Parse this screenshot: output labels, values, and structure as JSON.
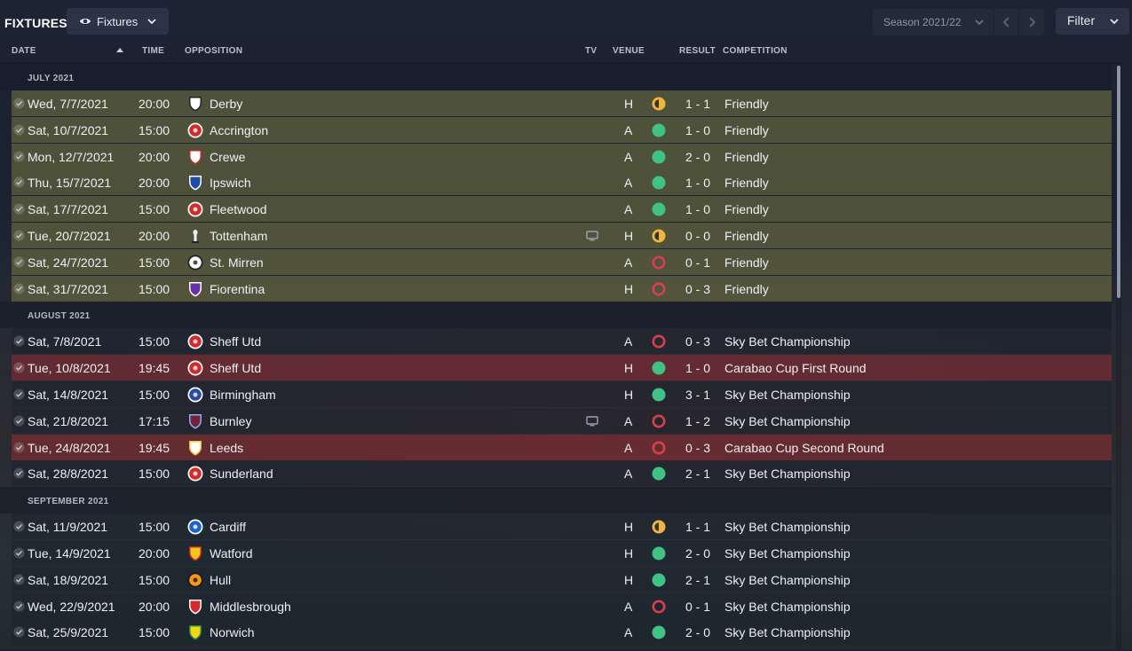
{
  "header": {
    "title": "FIXTURES",
    "view_label": "Fixtures",
    "season_label": "Season 2021/22",
    "filter_label": "Filter"
  },
  "columns": {
    "date": "DATE",
    "time": "TIME",
    "opposition": "OPPOSITION",
    "tv": "TV",
    "venue": "VENUE",
    "result": "RESULT",
    "competition": "COMPETITION"
  },
  "colors": {
    "win": "#3fc384",
    "draw": "#f0b540",
    "loss": "#d8404c",
    "july_row": "#707040",
    "cup_row": "#782c32"
  },
  "months": [
    {
      "label": "JULY 2021",
      "fixtures": [
        {
          "date": "Wed, 7/7/2021",
          "time": "20:00",
          "opponent": "Derby",
          "crest": "derby-ram",
          "tv": false,
          "venue": "H",
          "outcome": "draw",
          "score": "1 - 1",
          "competition": "Friendly",
          "highlight": "friendly"
        },
        {
          "date": "Sat, 10/7/2021",
          "time": "15:00",
          "opponent": "Accrington",
          "crest": "accrington",
          "tv": false,
          "venue": "A",
          "outcome": "win",
          "score": "1 - 0",
          "competition": "Friendly",
          "highlight": "friendly"
        },
        {
          "date": "Mon, 12/7/2021",
          "time": "20:00",
          "opponent": "Crewe",
          "crest": "crewe",
          "tv": false,
          "venue": "A",
          "outcome": "win",
          "score": "2 - 0",
          "competition": "Friendly",
          "highlight": "friendly"
        },
        {
          "date": "Thu, 15/7/2021",
          "time": "20:00",
          "opponent": "Ipswich",
          "crest": "ipswich",
          "tv": false,
          "venue": "A",
          "outcome": "win",
          "score": "1 - 0",
          "competition": "Friendly",
          "highlight": "friendly"
        },
        {
          "date": "Sat, 17/7/2021",
          "time": "15:00",
          "opponent": "Fleetwood",
          "crest": "fleetwood",
          "tv": false,
          "venue": "A",
          "outcome": "win",
          "score": "1 - 0",
          "competition": "Friendly",
          "highlight": "friendly"
        },
        {
          "date": "Tue, 20/7/2021",
          "time": "20:00",
          "opponent": "Tottenham",
          "crest": "tottenham",
          "tv": true,
          "venue": "H",
          "outcome": "draw",
          "score": "0 - 0",
          "competition": "Friendly",
          "highlight": "friendly"
        },
        {
          "date": "Sat, 24/7/2021",
          "time": "15:00",
          "opponent": "St. Mirren",
          "crest": "st-mirren",
          "tv": false,
          "venue": "A",
          "outcome": "loss",
          "score": "0 - 1",
          "competition": "Friendly",
          "highlight": "friendly"
        },
        {
          "date": "Sat, 31/7/2021",
          "time": "15:00",
          "opponent": "Fiorentina",
          "crest": "fiorentina",
          "tv": false,
          "venue": "H",
          "outcome": "loss",
          "score": "0 - 3",
          "competition": "Friendly",
          "highlight": "friendly"
        }
      ]
    },
    {
      "label": "AUGUST 2021",
      "fixtures": [
        {
          "date": "Sat, 7/8/2021",
          "time": "15:00",
          "opponent": "Sheff Utd",
          "crest": "sheff-utd",
          "tv": false,
          "venue": "A",
          "outcome": "loss",
          "score": "0 - 3",
          "competition": "Sky Bet Championship",
          "highlight": "normal"
        },
        {
          "date": "Tue, 10/8/2021",
          "time": "19:45",
          "opponent": "Sheff Utd",
          "crest": "sheff-utd",
          "tv": false,
          "venue": "H",
          "outcome": "win",
          "score": "1 - 0",
          "competition": "Carabao Cup First Round",
          "highlight": "cup"
        },
        {
          "date": "Sat, 14/8/2021",
          "time": "15:00",
          "opponent": "Birmingham",
          "crest": "birmingham",
          "tv": false,
          "venue": "H",
          "outcome": "win",
          "score": "3 - 1",
          "competition": "Sky Bet Championship",
          "highlight": "normal"
        },
        {
          "date": "Sat, 21/8/2021",
          "time": "17:15",
          "opponent": "Burnley",
          "crest": "burnley",
          "tv": true,
          "venue": "A",
          "outcome": "loss",
          "score": "1 - 2",
          "competition": "Sky Bet Championship",
          "highlight": "normal"
        },
        {
          "date": "Tue, 24/8/2021",
          "time": "19:45",
          "opponent": "Leeds",
          "crest": "leeds",
          "tv": false,
          "venue": "A",
          "outcome": "loss",
          "score": "0 - 3",
          "competition": "Carabao Cup Second Round",
          "highlight": "cup"
        },
        {
          "date": "Sat, 28/8/2021",
          "time": "15:00",
          "opponent": "Sunderland",
          "crest": "sunderland",
          "tv": false,
          "venue": "A",
          "outcome": "win",
          "score": "2 - 1",
          "competition": "Sky Bet Championship",
          "highlight": "normal"
        }
      ]
    },
    {
      "label": "SEPTEMBER 2021",
      "fixtures": [
        {
          "date": "Sat, 11/9/2021",
          "time": "15:00",
          "opponent": "Cardiff",
          "crest": "cardiff",
          "tv": false,
          "venue": "H",
          "outcome": "draw",
          "score": "1 - 1",
          "competition": "Sky Bet Championship",
          "highlight": "normal"
        },
        {
          "date": "Tue, 14/9/2021",
          "time": "20:00",
          "opponent": "Watford",
          "crest": "watford",
          "tv": false,
          "venue": "H",
          "outcome": "win",
          "score": "2 - 0",
          "competition": "Sky Bet Championship",
          "highlight": "normal"
        },
        {
          "date": "Sat, 18/9/2021",
          "time": "15:00",
          "opponent": "Hull",
          "crest": "hull",
          "tv": false,
          "venue": "H",
          "outcome": "win",
          "score": "2 - 1",
          "competition": "Sky Bet Championship",
          "highlight": "normal"
        },
        {
          "date": "Wed, 22/9/2021",
          "time": "20:00",
          "opponent": "Middlesbrough",
          "crest": "middlesbrough",
          "tv": false,
          "venue": "A",
          "outcome": "loss",
          "score": "0 - 1",
          "competition": "Sky Bet Championship",
          "highlight": "normal"
        },
        {
          "date": "Sat, 25/9/2021",
          "time": "15:00",
          "opponent": "Norwich",
          "crest": "norwich",
          "tv": false,
          "venue": "A",
          "outcome": "win",
          "score": "2 - 0",
          "competition": "Sky Bet Championship",
          "highlight": "normal"
        }
      ]
    }
  ]
}
